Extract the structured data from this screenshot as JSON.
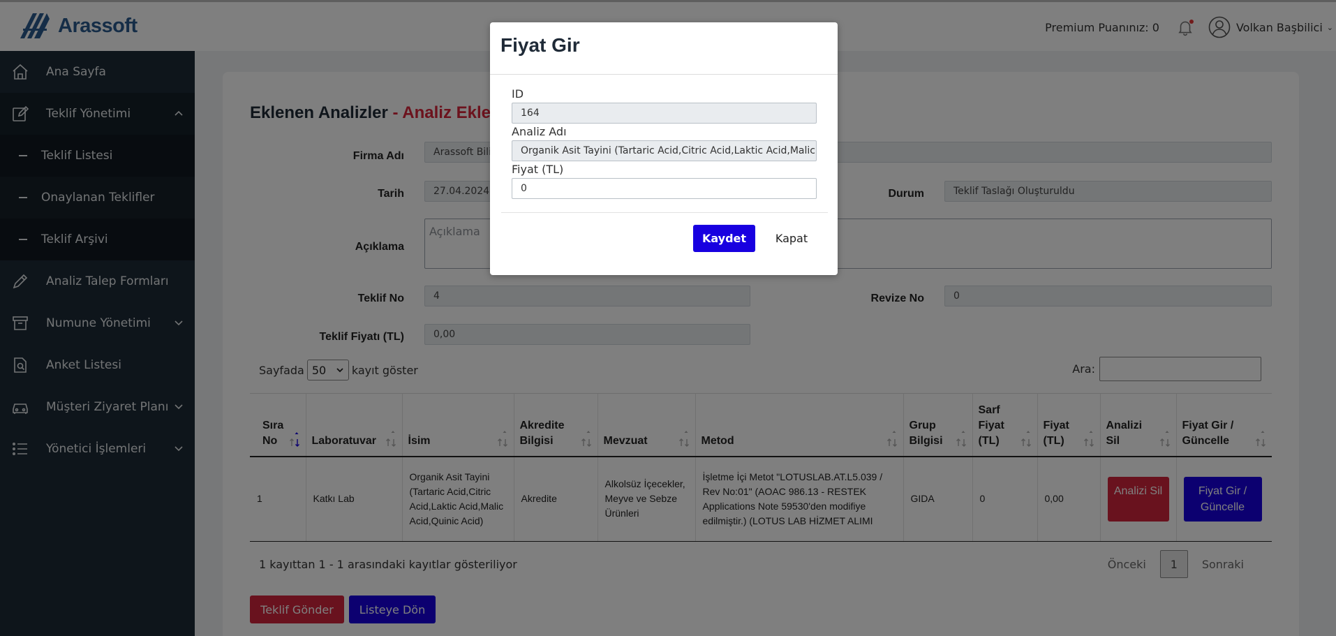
{
  "header": {
    "logo_text": "Arassoft",
    "premium_text": "Premium Puanınız: 0",
    "user_name": "Volkan Başbilici"
  },
  "sidebar": {
    "items": [
      {
        "label": "Ana Sayfa",
        "icon": "home-icon"
      },
      {
        "label": "Teklif Yönetimi",
        "icon": "edit-icon",
        "expanded": true
      },
      {
        "label": "Teklif Listesi"
      },
      {
        "label": "Onaylanan Teklifler"
      },
      {
        "label": "Teklif Arşivi"
      },
      {
        "label": "Analiz Talep Formları",
        "icon": "pencil-icon"
      },
      {
        "label": "Numune Yönetimi",
        "icon": "archive-icon"
      },
      {
        "label": "Anket Listesi",
        "icon": "survey-icon"
      },
      {
        "label": "Müşteri Ziyaret Planı",
        "icon": "car-icon"
      },
      {
        "label": "Yönetici İşlemleri",
        "icon": "list-icon"
      }
    ]
  },
  "page": {
    "title_main": "Eklenen Analizler",
    "title_accent": " - Analiz Ekle",
    "labels": {
      "firma": "Firma Adı",
      "tarih": "Tarih",
      "durum": "Durum",
      "aciklama": "Açıklama",
      "teklif_no": "Teklif No",
      "revize_no": "Revize No",
      "teklif_fiyati": "Teklif Fiyatı (TL)"
    },
    "values": {
      "firma": "Arassoft Bilişim",
      "tarih": "27.04.2024",
      "durum": "Teklif Taslağı Oluşturuldu",
      "aciklama_placeholder": "Açıklama",
      "teklif_no": "4",
      "revize_no": "0",
      "teklif_fiyati": "0,00"
    }
  },
  "table_controls": {
    "length_prefix": "Sayfada",
    "length_value": "50",
    "length_suffix": "kayıt göster",
    "search_label": "Ara:"
  },
  "table": {
    "headers": [
      "Sıra No",
      "Laboratuvar",
      "İsim",
      "Akredite Bilgisi",
      "Mevzuat",
      "Metod",
      "Grup Bilgisi",
      "Sarf Fiyat (TL)",
      "Fiyat (TL)",
      "Analizi Sil",
      "Fiyat Gir / Güncelle"
    ],
    "rows": [
      {
        "sira": "1",
        "lab": "Katkı Lab",
        "isim": "Organik Asit Tayini (Tartaric Acid,Citric Acid,Laktic Acid,Malic Acid,Quinic Acid)",
        "akredite": "Akredite",
        "mevzuat": "Alkolsüz İçecekler, Meyve ve Sebze Ürünleri",
        "metod": "İşletme İçi Metot \"LOTUSLAB.AT.L5.039 / Rev No:01\" (AOAC 986.13 - RESTEK Applications Note 59530'den modifiye edilmiştir.) (LOTUS LAB HİZMET ALIMI",
        "grup": "GIDA",
        "sarf": "0",
        "fiyat": "0,00",
        "delete_label": "Analizi Sil",
        "price_label": "Fiyat Gir / Güncelle"
      }
    ]
  },
  "footer": {
    "info": "1 kayıttan 1 - 1 arasındaki kayıtlar gösteriliyor",
    "prev": "Önceki",
    "page": "1",
    "next": "Sonraki",
    "send_label": "Teklif Gönder",
    "back_label": "Listeye Dön"
  },
  "modal": {
    "title": "Fiyat Gir",
    "id_label": "ID",
    "id_value": "164",
    "name_label": "Analiz Adı",
    "name_value": "Organik Asit Tayini (Tartaric Acid,Citric Acid,Laktic Acid,Malic Acid,Quinic Acid)",
    "price_label": "Fiyat (TL)",
    "price_value": "0",
    "save_label": "Kaydet",
    "close_label": "Kapat"
  },
  "colors": {
    "sidebar_bg": "#1d2a36",
    "accent_red": "#d3253c",
    "accent_blue": "#1800e0",
    "logo_blue": "#2a5b8f"
  }
}
